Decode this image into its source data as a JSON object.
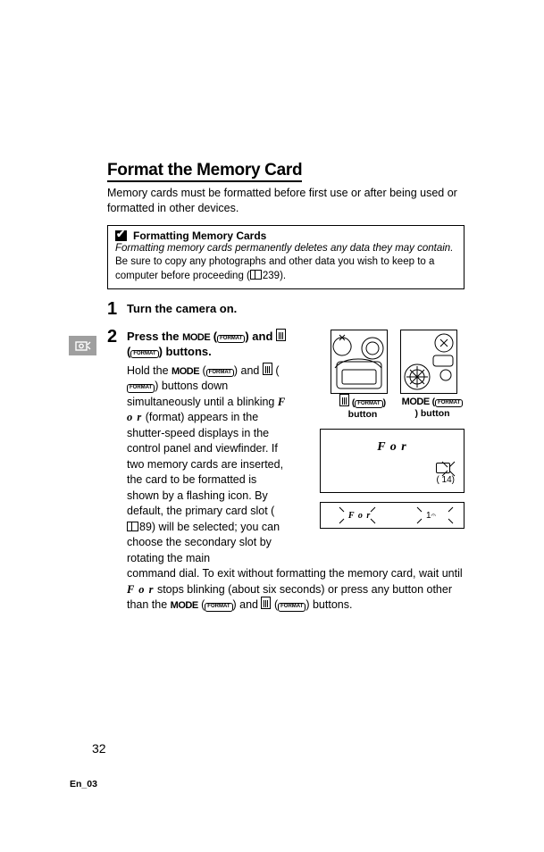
{
  "title": "Format the Memory Card",
  "intro": "Memory cards must be formatted before first use or after being used or formatted in other devices.",
  "caution": {
    "header": "Formatting Memory Cards",
    "body_italic": "Formatting memory cards permanently deletes any data they may contain.",
    "body_plain_prefix": " Be sure to copy any photographs and other data you wish to keep to a computer before proceeding (",
    "body_ref": "239",
    "body_plain_suffix": ")."
  },
  "steps": {
    "s1": {
      "num": "1",
      "title": "Turn the camera on."
    },
    "s2": {
      "num": "2",
      "title_prefix": "Press the ",
      "title_mode": "MODE",
      "title_mid": " (",
      "title_format": "FORMAT",
      "title_and": ") and ",
      "title_suffix": " (",
      "title_buttons": ") buttons.",
      "body": {
        "p1_a": "Hold the ",
        "p1_mode": "MODE",
        "p1_b": " (",
        "p1_c": ") and ",
        "p1_d": " (",
        "p1_e": ") buttons down simultaneously until a blinking ",
        "p1_for": "F o r",
        "p1_f": " (format) appears in the shutter-speed displays in the control panel and viewfinder. If two memory cards are inserted, the card to be formatted is shown by a flashing icon. By default, the primary card slot (",
        "p1_ref": "89",
        "p1_g": ") will be selected; you can choose the secondary slot by rotating the main"
      },
      "continuation": {
        "a": "command dial. To exit without formatting the memory card, wait until ",
        "for": "F o r",
        "b": " stops blinking (about six seconds) or press any button other than the ",
        "mode": "MODE",
        "c": " (",
        "d": ") and ",
        "e": " (",
        "f": ") buttons."
      }
    }
  },
  "illus": {
    "cap1_a": " (",
    "cap1_b": ") button",
    "cap2_mode": "MODE",
    "cap2_a": " (",
    "cap2_b": ") button",
    "panel1_for": "F o r",
    "panel2_for": "F o r",
    "panel2_num": "1𝄐"
  },
  "page_num": "32",
  "footer": "En_03"
}
